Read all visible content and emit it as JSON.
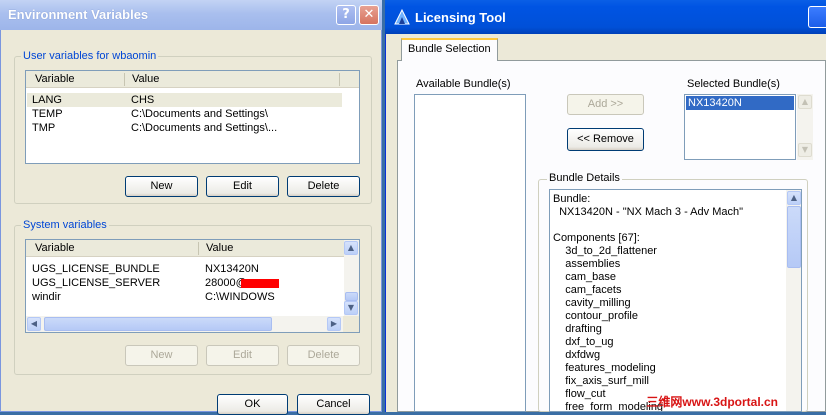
{
  "env": {
    "title": "Environment Variables",
    "help_label": "?",
    "close_label": "✕",
    "user_group_label": "User variables for wbaomin",
    "user_columns": [
      "Variable",
      "Value"
    ],
    "user_rows": [
      {
        "variable": "LANG",
        "value": "CHS"
      },
      {
        "variable": "TEMP",
        "value": "C:\\Documents and Settings\\"
      },
      {
        "variable": "TMP",
        "value": "C:\\Documents and Settings\\..."
      }
    ],
    "user_buttons": {
      "new": "New",
      "edit": "Edit",
      "delete": "Delete"
    },
    "system_group_label": "System variables",
    "system_columns": [
      "Variable",
      "Value"
    ],
    "system_rows": [
      {
        "variable": "UGS_LICENSE_BUNDLE",
        "value": "NX13420N"
      },
      {
        "variable": "UGS_LICENSE_SERVER",
        "value": "28000@"
      },
      {
        "variable": "windir",
        "value": "C:\\WINDOWS"
      }
    ],
    "system_buttons": {
      "new": "New",
      "edit": "Edit",
      "delete": "Delete"
    },
    "ok_label": "OK",
    "cancel_label": "Cancel"
  },
  "lic": {
    "title": "Licensing Tool",
    "tab_label": "Bundle Selection",
    "available_label": "Available Bundle(s)",
    "selected_label": "Selected Bundle(s)",
    "add_label": "Add >>",
    "remove_label": "<< Remove",
    "selected_items": [
      "NX13420N"
    ],
    "details_label": "Bundle Details",
    "details_lines": [
      "Bundle:",
      "  NX13420N - \"NX Mach 3 - Adv Mach\"",
      "",
      "Components [67]:",
      "    3d_to_2d_flattener",
      "    assemblies",
      "    cam_base",
      "    cam_facets",
      "    cavity_milling",
      "    contour_profile",
      "    drafting",
      "    dxf_to_ug",
      "    dxfdwg",
      "    features_modeling",
      "    fix_axis_surf_mill",
      "    flow_cut",
      "    free_form_modeling"
    ]
  },
  "watermark": "三维网www.3dportal.cn",
  "colors": {
    "selection": "#316ac5",
    "redaction": "#ff0000",
    "xp_title_blue": "#0054e3"
  }
}
